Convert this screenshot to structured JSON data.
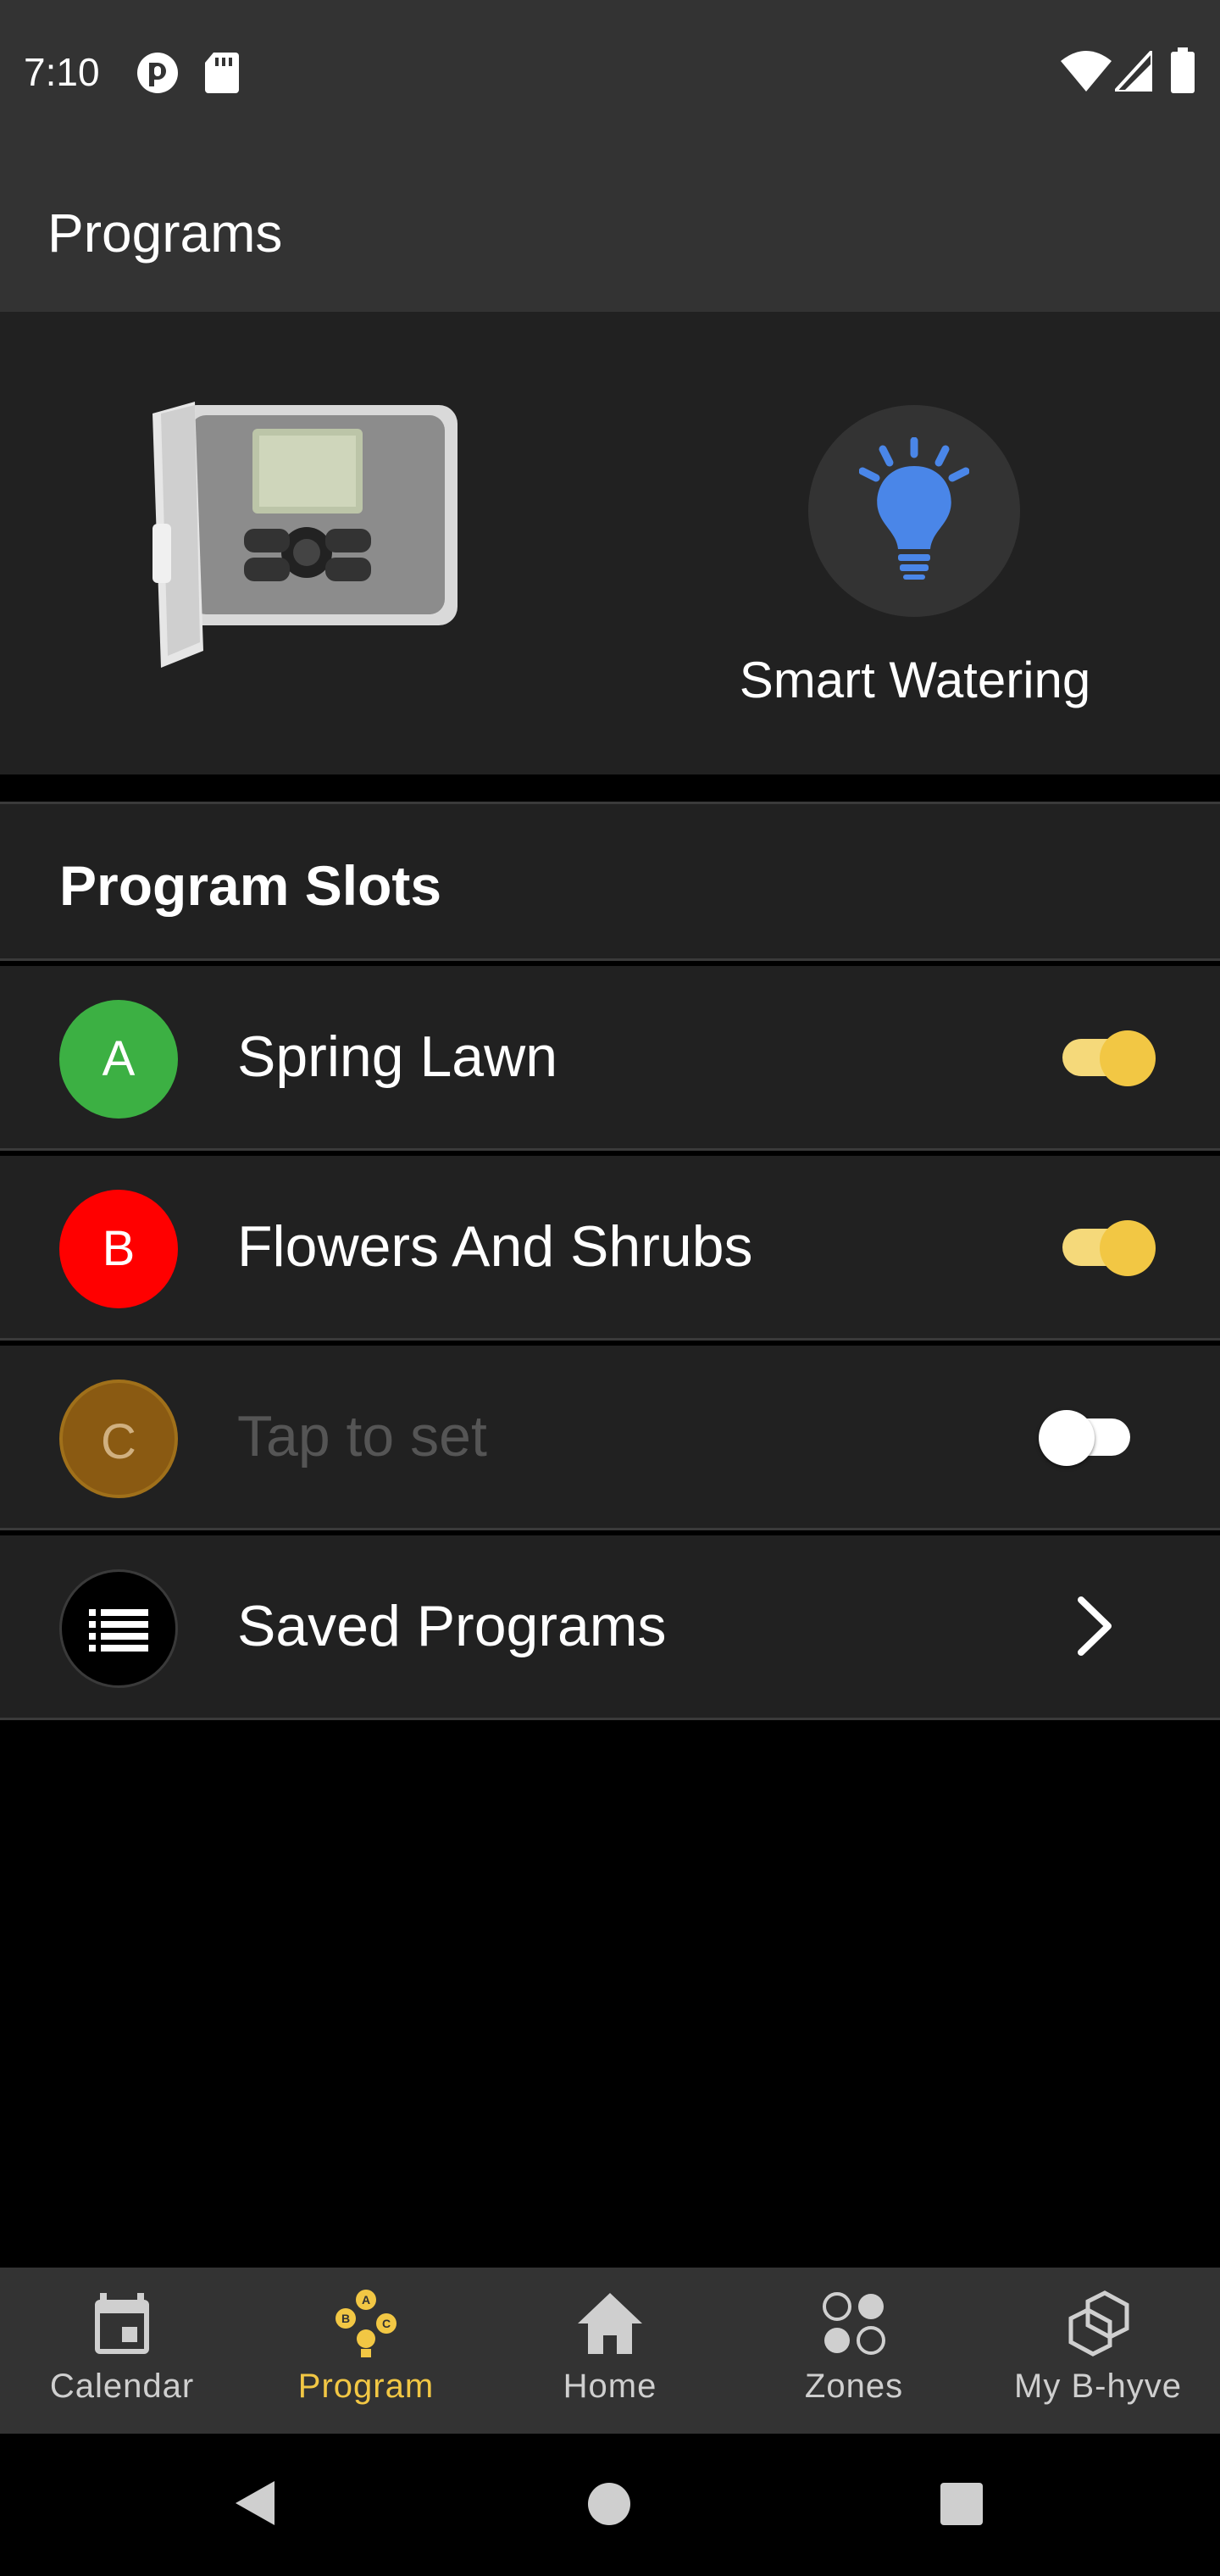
{
  "status_bar": {
    "time": "7:10",
    "left_icons": [
      "sync-icon",
      "sd-card-icon"
    ],
    "right_icons": [
      "wifi-icon",
      "signal-icon",
      "battery-icon"
    ]
  },
  "app_bar": {
    "title": "Programs"
  },
  "hero": {
    "image": "sprinkler-controller-image",
    "smart_watering_label": "Smart Watering",
    "smart_watering_icon": "lightbulb-icon",
    "icon_color": "#4a86e8"
  },
  "program_slots": {
    "title": "Program Slots",
    "slots": [
      {
        "letter": "A",
        "label": "Spring Lawn",
        "enabled": true,
        "color": "#3cb043"
      },
      {
        "letter": "B",
        "label": "Flowers And Shrubs",
        "enabled": true,
        "color": "#ff0000"
      },
      {
        "letter": "C",
        "label": "Tap to set",
        "enabled": false,
        "color": "#8a5a12"
      }
    ],
    "saved_programs": {
      "label": "Saved Programs",
      "icon": "list-icon"
    }
  },
  "bottom_nav": {
    "items": [
      {
        "label": "Calendar",
        "icon": "calendar-icon",
        "active": false
      },
      {
        "label": "Program",
        "icon": "program-abc-icon",
        "active": true
      },
      {
        "label": "Home",
        "icon": "home-icon",
        "active": false
      },
      {
        "label": "Zones",
        "icon": "zones-icon",
        "active": false
      },
      {
        "label": "My B-hyve",
        "icon": "b-hyve-icon",
        "active": false
      }
    ]
  },
  "accent_color": "#f2c744",
  "system_nav": [
    "back-icon",
    "home-circle-icon",
    "recents-icon"
  ]
}
